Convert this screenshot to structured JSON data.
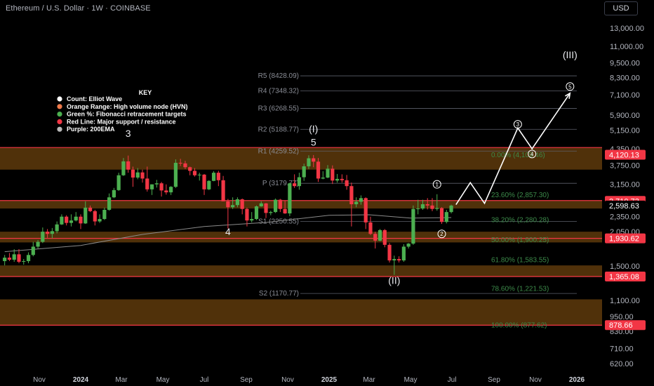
{
  "header": {
    "symbol": "Ethereum / U.S. Dollar · 1W · COINBASE",
    "currency_button": "USD"
  },
  "colors": {
    "background": "#000000",
    "up_candle": "#4caf50",
    "down_candle": "#f23645",
    "hvn_zone": "#5e3a0c",
    "resistance_line": "#f23645",
    "fib_text": "#3c8a4a",
    "pivot_line": "#5d606b",
    "ema": "#8a8a8a",
    "projection": "#ffffff"
  },
  "chart_data": {
    "type": "candlestick",
    "title": "Ethereum / U.S. Dollar · 1W · COINBASE",
    "y_scale": "log",
    "ylim": [
      560,
      17500
    ],
    "y_ticks": [
      "13,000.00",
      "11,000.00",
      "9,500.00",
      "8,300.00",
      "7,100.00",
      "5,900.00",
      "5,150.00",
      "4,350.00",
      "3,750.00",
      "3,150.00",
      "2,350.00",
      "2,050.00",
      "1,500.00",
      "1,100.00",
      "950.00",
      "830.00",
      "710.00",
      "620.00"
    ],
    "y_tick_values": [
      13000,
      11000,
      9500,
      8300,
      7100,
      5900,
      5150,
      4350,
      3750,
      3150,
      2350,
      2050,
      1500,
      1100,
      950,
      830,
      710,
      620
    ],
    "x_ticks": [
      {
        "label": "Nov",
        "date": "2023-11-01",
        "bold": false
      },
      {
        "label": "2024",
        "date": "2024-01-01",
        "bold": true
      },
      {
        "label": "Mar",
        "date": "2024-03-01",
        "bold": false
      },
      {
        "label": "May",
        "date": "2024-05-01",
        "bold": false
      },
      {
        "label": "Jul",
        "date": "2024-07-01",
        "bold": false
      },
      {
        "label": "Sep",
        "date": "2024-09-01",
        "bold": false
      },
      {
        "label": "Nov",
        "date": "2024-11-01",
        "bold": false
      },
      {
        "label": "2025",
        "date": "2025-01-01",
        "bold": true
      },
      {
        "label": "Mar",
        "date": "2025-03-01",
        "bold": false
      },
      {
        "label": "May",
        "date": "2025-05-01",
        "bold": false
      },
      {
        "label": "Jul",
        "date": "2025-07-01",
        "bold": false
      },
      {
        "label": "Sep",
        "date": "2025-09-01",
        "bold": false
      },
      {
        "label": "Nov",
        "date": "2025-11-01",
        "bold": false
      },
      {
        "label": "2026",
        "date": "2026-01-01",
        "bold": true
      }
    ],
    "candles": [
      {
        "date": "2023-09-11",
        "o": 1570,
        "h": 1660,
        "l": 1510,
        "c": 1620
      },
      {
        "date": "2023-09-18",
        "o": 1620,
        "h": 1690,
        "l": 1570,
        "c": 1590
      },
      {
        "date": "2023-09-25",
        "o": 1590,
        "h": 1750,
        "l": 1560,
        "c": 1670
      },
      {
        "date": "2023-10-02",
        "o": 1670,
        "h": 1750,
        "l": 1540,
        "c": 1560
      },
      {
        "date": "2023-10-09",
        "o": 1560,
        "h": 1600,
        "l": 1520,
        "c": 1570
      },
      {
        "date": "2023-10-16",
        "o": 1570,
        "h": 1700,
        "l": 1540,
        "c": 1660
      },
      {
        "date": "2023-10-23",
        "o": 1660,
        "h": 1870,
        "l": 1640,
        "c": 1790
      },
      {
        "date": "2023-10-30",
        "o": 1790,
        "h": 1900,
        "l": 1760,
        "c": 1870
      },
      {
        "date": "2023-11-06",
        "o": 1870,
        "h": 2130,
        "l": 1850,
        "c": 2050
      },
      {
        "date": "2023-11-13",
        "o": 2050,
        "h": 2100,
        "l": 1940,
        "c": 2010
      },
      {
        "date": "2023-11-20",
        "o": 2010,
        "h": 2120,
        "l": 1930,
        "c": 2060
      },
      {
        "date": "2023-11-27",
        "o": 2060,
        "h": 2250,
        "l": 2020,
        "c": 2190
      },
      {
        "date": "2023-12-04",
        "o": 2190,
        "h": 2400,
        "l": 2180,
        "c": 2350
      },
      {
        "date": "2023-12-11",
        "o": 2350,
        "h": 2380,
        "l": 2170,
        "c": 2220
      },
      {
        "date": "2023-12-18",
        "o": 2220,
        "h": 2400,
        "l": 2150,
        "c": 2270
      },
      {
        "date": "2023-12-25",
        "o": 2270,
        "h": 2450,
        "l": 2250,
        "c": 2350
      },
      {
        "date": "2024-01-01",
        "o": 2350,
        "h": 2400,
        "l": 2100,
        "c": 2210
      },
      {
        "date": "2024-01-08",
        "o": 2210,
        "h": 2700,
        "l": 2200,
        "c": 2550
      },
      {
        "date": "2024-01-15",
        "o": 2550,
        "h": 2600,
        "l": 2450,
        "c": 2470
      },
      {
        "date": "2024-01-22",
        "o": 2470,
        "h": 2500,
        "l": 2170,
        "c": 2250
      },
      {
        "date": "2024-01-29",
        "o": 2250,
        "h": 2400,
        "l": 2220,
        "c": 2300
      },
      {
        "date": "2024-02-05",
        "o": 2300,
        "h": 2550,
        "l": 2280,
        "c": 2500
      },
      {
        "date": "2024-02-12",
        "o": 2500,
        "h": 2900,
        "l": 2480,
        "c": 2800
      },
      {
        "date": "2024-02-19",
        "o": 2800,
        "h": 3050,
        "l": 2780,
        "c": 2990
      },
      {
        "date": "2024-02-26",
        "o": 2990,
        "h": 3500,
        "l": 2970,
        "c": 3420
      },
      {
        "date": "2024-03-04",
        "o": 3420,
        "h": 4000,
        "l": 3400,
        "c": 3880
      },
      {
        "date": "2024-03-11",
        "o": 3880,
        "h": 4090,
        "l": 3500,
        "c": 3600
      },
      {
        "date": "2024-03-18",
        "o": 3600,
        "h": 3700,
        "l": 3080,
        "c": 3350
      },
      {
        "date": "2024-03-25",
        "o": 3350,
        "h": 3650,
        "l": 3300,
        "c": 3510
      },
      {
        "date": "2024-04-01",
        "o": 3510,
        "h": 3600,
        "l": 3200,
        "c": 3320
      },
      {
        "date": "2024-04-08",
        "o": 3320,
        "h": 3700,
        "l": 2950,
        "c": 3010
      },
      {
        "date": "2024-04-15",
        "o": 3010,
        "h": 3150,
        "l": 2860,
        "c": 3150
      },
      {
        "date": "2024-04-22",
        "o": 3150,
        "h": 3280,
        "l": 3060,
        "c": 3180
      },
      {
        "date": "2024-04-29",
        "o": 3180,
        "h": 3220,
        "l": 2820,
        "c": 2980
      },
      {
        "date": "2024-05-06",
        "o": 2980,
        "h": 3150,
        "l": 2870,
        "c": 2930
      },
      {
        "date": "2024-05-13",
        "o": 2930,
        "h": 3100,
        "l": 2860,
        "c": 3080
      },
      {
        "date": "2024-05-20",
        "o": 3080,
        "h": 3950,
        "l": 3050,
        "c": 3830
      },
      {
        "date": "2024-05-27",
        "o": 3830,
        "h": 3970,
        "l": 3720,
        "c": 3810
      },
      {
        "date": "2024-06-03",
        "o": 3810,
        "h": 3900,
        "l": 3620,
        "c": 3680
      },
      {
        "date": "2024-06-10",
        "o": 3680,
        "h": 3700,
        "l": 3420,
        "c": 3560
      },
      {
        "date": "2024-06-17",
        "o": 3560,
        "h": 3650,
        "l": 3380,
        "c": 3420
      },
      {
        "date": "2024-06-24",
        "o": 3420,
        "h": 3500,
        "l": 3260,
        "c": 3440
      },
      {
        "date": "2024-07-01",
        "o": 3440,
        "h": 3460,
        "l": 2860,
        "c": 3010
      },
      {
        "date": "2024-07-08",
        "o": 3010,
        "h": 3270,
        "l": 2990,
        "c": 3250
      },
      {
        "date": "2024-07-15",
        "o": 3250,
        "h": 3550,
        "l": 3240,
        "c": 3500
      },
      {
        "date": "2024-07-22",
        "o": 3500,
        "h": 3560,
        "l": 3100,
        "c": 3270
      },
      {
        "date": "2024-07-29",
        "o": 3270,
        "h": 3400,
        "l": 2800,
        "c": 2700
      },
      {
        "date": "2024-08-05",
        "o": 2700,
        "h": 2760,
        "l": 2110,
        "c": 2560
      },
      {
        "date": "2024-08-12",
        "o": 2560,
        "h": 2800,
        "l": 2520,
        "c": 2610
      },
      {
        "date": "2024-08-19",
        "o": 2610,
        "h": 2800,
        "l": 2560,
        "c": 2750
      },
      {
        "date": "2024-08-26",
        "o": 2750,
        "h": 2770,
        "l": 2400,
        "c": 2520
      },
      {
        "date": "2024-09-02",
        "o": 2520,
        "h": 2550,
        "l": 2150,
        "c": 2270
      },
      {
        "date": "2024-09-09",
        "o": 2270,
        "h": 2450,
        "l": 2230,
        "c": 2300
      },
      {
        "date": "2024-09-16",
        "o": 2300,
        "h": 2600,
        "l": 2280,
        "c": 2580
      },
      {
        "date": "2024-09-23",
        "o": 2580,
        "h": 2700,
        "l": 2570,
        "c": 2650
      },
      {
        "date": "2024-09-30",
        "o": 2650,
        "h": 2660,
        "l": 2320,
        "c": 2430
      },
      {
        "date": "2024-10-07",
        "o": 2430,
        "h": 2480,
        "l": 2380,
        "c": 2450
      },
      {
        "date": "2024-10-14",
        "o": 2450,
        "h": 2770,
        "l": 2430,
        "c": 2740
      },
      {
        "date": "2024-10-21",
        "o": 2740,
        "h": 2760,
        "l": 2450,
        "c": 2520
      },
      {
        "date": "2024-10-28",
        "o": 2520,
        "h": 2720,
        "l": 2410,
        "c": 2420
      },
      {
        "date": "2024-11-04",
        "o": 2420,
        "h": 3200,
        "l": 2360,
        "c": 3180
      },
      {
        "date": "2024-11-11",
        "o": 3180,
        "h": 3450,
        "l": 3050,
        "c": 3100
      },
      {
        "date": "2024-11-18",
        "o": 3100,
        "h": 3500,
        "l": 3000,
        "c": 3360
      },
      {
        "date": "2024-11-25",
        "o": 3360,
        "h": 3800,
        "l": 3250,
        "c": 3710
      },
      {
        "date": "2024-12-02",
        "o": 3710,
        "h": 4100,
        "l": 3620,
        "c": 3990
      },
      {
        "date": "2024-12-09",
        "o": 3990,
        "h": 4110,
        "l": 3680,
        "c": 3870
      },
      {
        "date": "2024-12-16",
        "o": 3870,
        "h": 4000,
        "l": 3220,
        "c": 3320
      },
      {
        "date": "2024-12-23",
        "o": 3320,
        "h": 3550,
        "l": 3300,
        "c": 3350
      },
      {
        "date": "2024-12-30",
        "o": 3350,
        "h": 3750,
        "l": 3330,
        "c": 3630
      },
      {
        "date": "2025-01-06",
        "o": 3630,
        "h": 3740,
        "l": 3160,
        "c": 3260
      },
      {
        "date": "2025-01-13",
        "o": 3260,
        "h": 3460,
        "l": 3200,
        "c": 3310
      },
      {
        "date": "2025-01-20",
        "o": 3310,
        "h": 3450,
        "l": 3200,
        "c": 3270
      },
      {
        "date": "2025-01-27",
        "o": 3270,
        "h": 3430,
        "l": 3000,
        "c": 3100
      },
      {
        "date": "2025-02-03",
        "o": 3100,
        "h": 3200,
        "l": 2150,
        "c": 2630
      },
      {
        "date": "2025-02-10",
        "o": 2630,
        "h": 2800,
        "l": 2560,
        "c": 2690
      },
      {
        "date": "2025-02-17",
        "o": 2690,
        "h": 2850,
        "l": 2620,
        "c": 2780
      },
      {
        "date": "2025-02-24",
        "o": 2780,
        "h": 2800,
        "l": 2100,
        "c": 2230
      },
      {
        "date": "2025-03-03",
        "o": 2230,
        "h": 2350,
        "l": 1990,
        "c": 2010
      },
      {
        "date": "2025-03-10",
        "o": 2010,
        "h": 2050,
        "l": 1760,
        "c": 1890
      },
      {
        "date": "2025-03-17",
        "o": 1890,
        "h": 2100,
        "l": 1880,
        "c": 2080
      },
      {
        "date": "2025-03-24",
        "o": 2080,
        "h": 2100,
        "l": 1780,
        "c": 1820
      },
      {
        "date": "2025-03-31",
        "o": 1820,
        "h": 1850,
        "l": 1550,
        "c": 1580
      },
      {
        "date": "2025-04-07",
        "o": 1580,
        "h": 1650,
        "l": 1385,
        "c": 1600
      },
      {
        "date": "2025-04-14",
        "o": 1600,
        "h": 1640,
        "l": 1550,
        "c": 1580
      },
      {
        "date": "2025-04-21",
        "o": 1580,
        "h": 1830,
        "l": 1560,
        "c": 1790
      },
      {
        "date": "2025-04-28",
        "o": 1790,
        "h": 1850,
        "l": 1760,
        "c": 1840
      },
      {
        "date": "2025-05-05",
        "o": 1840,
        "h": 2600,
        "l": 1820,
        "c": 2520
      },
      {
        "date": "2025-05-12",
        "o": 2520,
        "h": 2740,
        "l": 2400,
        "c": 2530
      },
      {
        "date": "2025-05-19",
        "o": 2530,
        "h": 2740,
        "l": 2500,
        "c": 2630
      },
      {
        "date": "2025-05-26",
        "o": 2630,
        "h": 2780,
        "l": 2510,
        "c": 2600
      },
      {
        "date": "2025-06-02",
        "o": 2600,
        "h": 2780,
        "l": 2470,
        "c": 2520
      },
      {
        "date": "2025-06-09",
        "o": 2520,
        "h": 2880,
        "l": 2480,
        "c": 2540
      },
      {
        "date": "2025-06-16",
        "o": 2540,
        "h": 2560,
        "l": 2200,
        "c": 2240
      },
      {
        "date": "2025-06-23",
        "o": 2240,
        "h": 2500,
        "l": 2210,
        "c": 2450
      },
      {
        "date": "2025-06-30",
        "o": 2450,
        "h": 2620,
        "l": 2420,
        "c": 2599
      }
    ],
    "ema200": [
      {
        "date": "2023-09-11",
        "v": 1710
      },
      {
        "date": "2024-01-01",
        "v": 1810
      },
      {
        "date": "2024-04-01",
        "v": 2000
      },
      {
        "date": "2024-07-01",
        "v": 2150
      },
      {
        "date": "2024-10-01",
        "v": 2230
      },
      {
        "date": "2025-01-01",
        "v": 2380
      },
      {
        "date": "2025-03-01",
        "v": 2390
      },
      {
        "date": "2025-05-01",
        "v": 2320
      },
      {
        "date": "2025-06-30",
        "v": 2330
      }
    ],
    "hvn_zones": [
      [
        3600,
        4400
      ],
      [
        2530,
        2720
      ],
      [
        1860,
        2050
      ],
      [
        1360,
        1510
      ],
      [
        878,
        1110
      ]
    ],
    "resistance_lines": [
      4400,
      2720,
      1930,
      1365,
      878
    ],
    "fib_levels": [
      {
        "label": "0.00% (4,109.46)",
        "value": 4109.46
      },
      {
        "label": "23.60% (2,857.30)",
        "value": 2857.3
      },
      {
        "label": "38.20% (2,280.28)",
        "value": 2280.28
      },
      {
        "label": "50.00% (1,900.25)",
        "value": 1900.25
      },
      {
        "label": "61.80% (1,583.55)",
        "value": 1583.55
      },
      {
        "label": "78.60% (1,221.53)",
        "value": 1221.53
      },
      {
        "label": "100.00% (877.62)",
        "value": 877.62
      }
    ],
    "pivots": [
      {
        "label": "R5 (8428.09)",
        "value": 8428.09
      },
      {
        "label": "R4 (7348.32)",
        "value": 7348.32
      },
      {
        "label": "R3 (6268.55)",
        "value": 6268.55
      },
      {
        "label": "R2 (5188.77)",
        "value": 5188.77
      },
      {
        "label": "R1 (4259.52)",
        "value": 4259.52
      },
      {
        "label": "P (3179.77)",
        "value": 3179.77
      },
      {
        "label": "S1 (2250.55)",
        "value": 2250.55
      },
      {
        "label": "S2 (1170.77)",
        "value": 1170.77
      }
    ],
    "projection": [
      {
        "date": "2025-07-07",
        "v": 2620
      },
      {
        "date": "2025-07-28",
        "v": 3200
      },
      {
        "date": "2025-08-18",
        "v": 2650
      },
      {
        "date": "2025-10-06",
        "v": 5250
      },
      {
        "date": "2025-10-27",
        "v": 4350
      },
      {
        "date": "2025-12-22",
        "v": 7200
      }
    ],
    "wave_labels": [
      {
        "text": "3",
        "date": "2024-03-11",
        "v": 4850
      },
      {
        "text": "4",
        "date": "2024-08-05",
        "v": 1990
      },
      {
        "text": "5",
        "date": "2024-12-09",
        "v": 4480
      },
      {
        "text": "(I)",
        "date": "2024-12-09",
        "v": 5050
      },
      {
        "text": "(II)",
        "date": "2025-04-07",
        "v": 1275
      },
      {
        "text": "(III)",
        "date": "2025-12-22",
        "v": 9900
      }
    ],
    "circled_labels": [
      {
        "text": "1",
        "date": "2025-06-09",
        "v": 3150
      },
      {
        "text": "2",
        "date": "2025-06-16",
        "v": 2010
      },
      {
        "text": "3",
        "date": "2025-10-06",
        "v": 5430
      },
      {
        "text": "4",
        "date": "2025-10-27",
        "v": 4150
      },
      {
        "text": "5",
        "date": "2025-12-22",
        "v": 7650
      }
    ],
    "price_tags": [
      {
        "label": "4,120.13",
        "value": 4120.13,
        "color": "#f23645"
      },
      {
        "label": "2,710.73",
        "value": 2710.73,
        "color": "#f23645"
      },
      {
        "label": "2,598.63",
        "value": 2598.63,
        "color": "#000000"
      },
      {
        "label": "1,930.62",
        "value": 1930.62,
        "color": "#f23645"
      },
      {
        "label": "1,365.08",
        "value": 1365.08,
        "color": "#f23645"
      },
      {
        "label": "878.66",
        "value": 878.66,
        "color": "#f23645"
      }
    ]
  },
  "key": {
    "title": "KEY",
    "items": [
      {
        "label": "Count: Elliot Wave",
        "color": "#ffffff"
      },
      {
        "label": "Orange Range: High volume node (HVN)",
        "color": "#f07a4a"
      },
      {
        "label": "Green %: Fibonacci retracement targets",
        "color": "#4caf50"
      },
      {
        "label": "Red Line: Major support / resistance",
        "color": "#f23645"
      },
      {
        "label": "Purple: 200EMA",
        "color": "#b8b8b8"
      }
    ]
  }
}
